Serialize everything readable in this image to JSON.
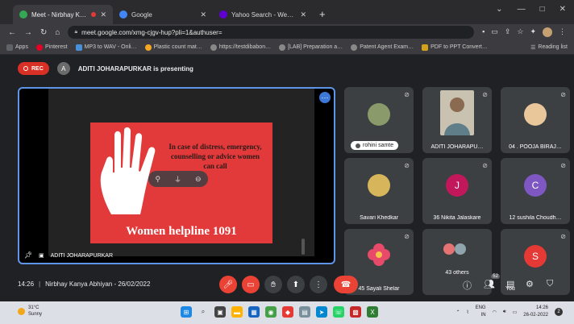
{
  "browser": {
    "tabs": [
      {
        "label": "Meet - Nirbhay Kanya Abhiy…",
        "favicon_color": "#34a853",
        "active": true,
        "recording": true
      },
      {
        "label": "Google",
        "favicon_color": "#4285f4",
        "active": false,
        "recording": false
      },
      {
        "label": "Yahoo Search - Web Search",
        "favicon_color": "#6001d2",
        "active": false,
        "recording": false
      }
    ],
    "new_tab": "+",
    "window_controls": [
      "⌄",
      "—",
      "□",
      "✕"
    ],
    "url": "meet.google.com/xmg-cjgv-hup?pli=1&authuser=",
    "bookmarks": [
      {
        "label": "Apps",
        "color": "#5f6368"
      },
      {
        "label": "Pinterest",
        "color": "#e60023"
      },
      {
        "label": "MP3 to WAV - Onli…",
        "color": "#4a90d9"
      },
      {
        "label": "Plastic count mat…",
        "color": "#f5a623"
      },
      {
        "label": "https://testdibabon…",
        "color": "#888888"
      },
      {
        "label": "[LAB] Preparation a…",
        "color": "#888888"
      },
      {
        "label": "Patent Agent Exam…",
        "color": "#888888"
      },
      {
        "label": "PDF to PPT Convert…",
        "color": "#d4a017"
      }
    ],
    "reading_list": "Reading list"
  },
  "meet": {
    "rec_label": "REC",
    "presenting_text": "ADITI JOHARAPURKAR is presenting",
    "presenter_name": "ADITI JOHARAPURKAR",
    "slide": {
      "overlay_text": "In case of distress, emergency, counselling or advice women can call",
      "title": "Women helpline 1091"
    },
    "participants": [
      {
        "name": "rohini samte",
        "type": "photo",
        "chip": true
      },
      {
        "name": "ADITI JOHARAPU…",
        "type": "video"
      },
      {
        "name": "04 . POOJA BIRAJ…",
        "type": "photo"
      },
      {
        "name": "Savari Khedkar",
        "type": "photo"
      },
      {
        "name": "36 Nikita Jalaskare",
        "type": "letter",
        "letter": "J",
        "color": "#c2185b"
      },
      {
        "name": "12 sushila Choudh…",
        "type": "letter",
        "letter": "C",
        "color": "#7e57c2"
      },
      {
        "name": "45 Sayali Shelar",
        "type": "flower"
      },
      {
        "name": "43 others",
        "type": "others"
      },
      {
        "name": "You",
        "type": "letter",
        "letter": "S",
        "color": "#e53935"
      }
    ],
    "time": "14:26",
    "meeting_title": "Nirbhay Kanya Abhiyan - 26/02/2022",
    "participant_count": "52"
  },
  "taskbar": {
    "temperature": "31°C",
    "weather": "Sunny",
    "lang_line1": "ENG",
    "lang_line2": "IN",
    "clock_time": "14:26",
    "clock_date": "26-02-2022",
    "notification_count": "2"
  }
}
